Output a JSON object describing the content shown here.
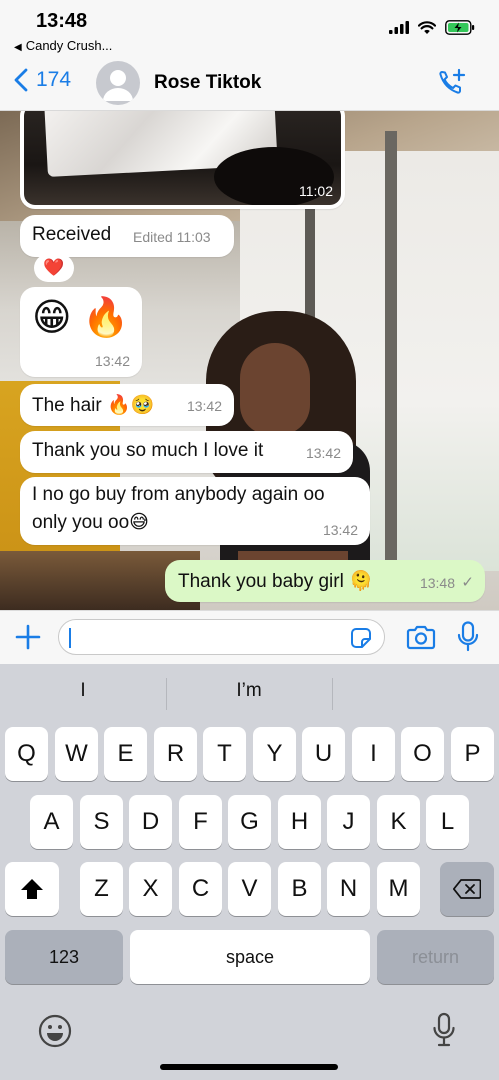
{
  "status_bar": {
    "time": "13:48",
    "back_app_label": "Candy Crush...",
    "icons": [
      "signal-icon",
      "wifi-icon",
      "battery-charging-icon"
    ]
  },
  "nav": {
    "back_count": "174",
    "contact_name": "Rose Tiktok",
    "call_icon": "add-call-icon"
  },
  "messages": [
    {
      "id": "photo",
      "direction": "incoming",
      "type": "photo",
      "time": "11:02"
    },
    {
      "id": "received",
      "direction": "incoming",
      "text": "Received",
      "edited_label": "Edited 11:03",
      "time": "",
      "reaction": "❤️"
    },
    {
      "id": "emojis",
      "direction": "incoming",
      "text": "😁 🔥",
      "time": "13:42"
    },
    {
      "id": "hair",
      "direction": "incoming",
      "text": "The hair 🔥🥹",
      "time": "13:42"
    },
    {
      "id": "thanks",
      "direction": "incoming",
      "text": "Thank you so much I love it",
      "time": "13:42"
    },
    {
      "id": "nobuy",
      "direction": "incoming",
      "text_line1": "I no go buy from anybody again oo",
      "text_line2": "only you oo😅",
      "time": "13:42"
    },
    {
      "id": "reply",
      "direction": "outgoing",
      "text": "Thank you baby girl 🫠",
      "time": "13:48",
      "status": "✓"
    }
  ],
  "composer": {
    "value": "",
    "placeholder": ""
  },
  "keyboard": {
    "suggestions": [
      "I",
      "I’m",
      ""
    ],
    "row1": [
      "Q",
      "W",
      "E",
      "R",
      "T",
      "Y",
      "U",
      "I",
      "O",
      "P"
    ],
    "row2": [
      "A",
      "S",
      "D",
      "F",
      "G",
      "H",
      "J",
      "K",
      "L"
    ],
    "row3": [
      "Z",
      "X",
      "C",
      "V",
      "B",
      "N",
      "M"
    ],
    "numbers_label": "123",
    "space_label": "space",
    "return_label": "return"
  },
  "colors": {
    "accent": "#1a7de6",
    "outgoing_bubble": "#dbf8c6",
    "incoming_bubble": "#ffffff",
    "keyboard_bg": "#d1d3d9"
  }
}
